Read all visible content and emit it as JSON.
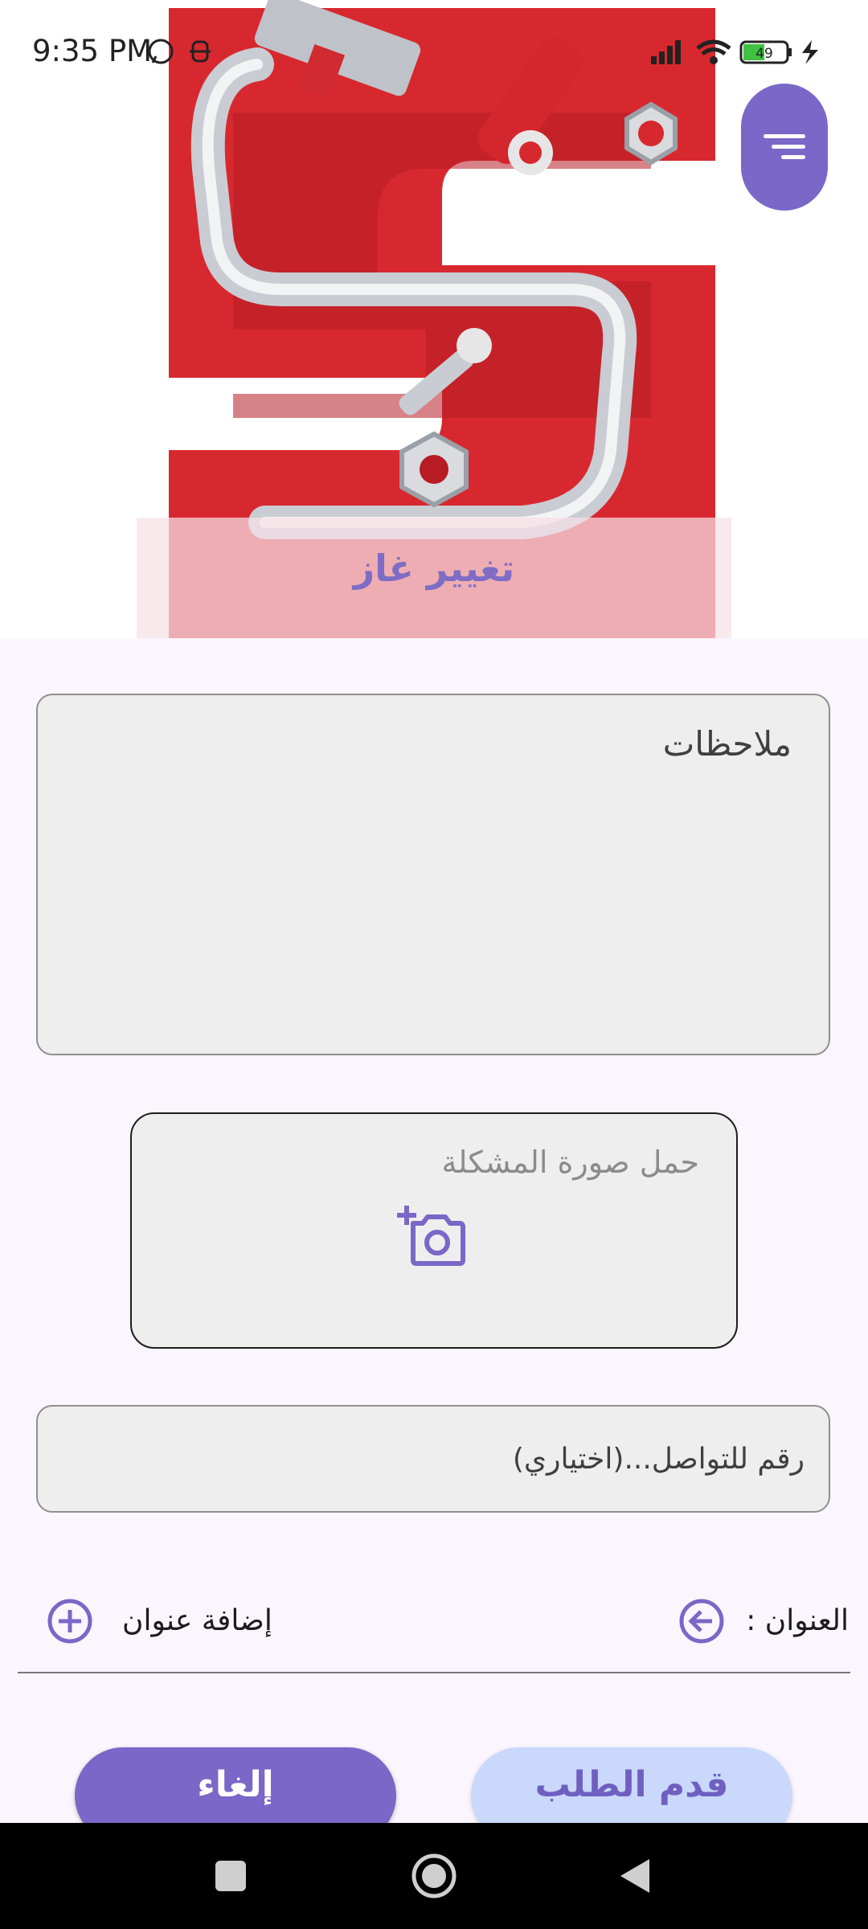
{
  "status_bar": {
    "time": "9:35 PM",
    "battery": "49",
    "icons": [
      "whatsapp-icon",
      "notification-icon",
      "signal-icon",
      "wifi-icon",
      "battery-icon",
      "charging-icon"
    ]
  },
  "header": {
    "logo_icon": "tools-s-logo-icon",
    "service_title": "تغيير غاز",
    "menu_icon": "filter-menu-icon"
  },
  "form": {
    "notes_placeholder": "ملاحظات",
    "upload_label": "حمل صورة المشكلة",
    "upload_icon": "add-photo-icon",
    "phone_placeholder": "رقم للتواصل...(اختياري)"
  },
  "address": {
    "label": "العنوان :",
    "add_label": "إضافة عنوان",
    "back_icon": "arrow-left-circle-icon",
    "add_icon": "plus-circle-icon"
  },
  "buttons": {
    "cancel_label": "إلغاء",
    "submit_label": "قدم الطلب"
  },
  "nav_bar": {
    "icons": [
      "recents-square-icon",
      "home-circle-icon",
      "back-triangle-icon"
    ]
  },
  "colors": {
    "accent": "#7a67c7",
    "submit_bg": "#c9d8fb",
    "logo_red": "#d8282f",
    "page_bg": "#fbf5fd"
  }
}
